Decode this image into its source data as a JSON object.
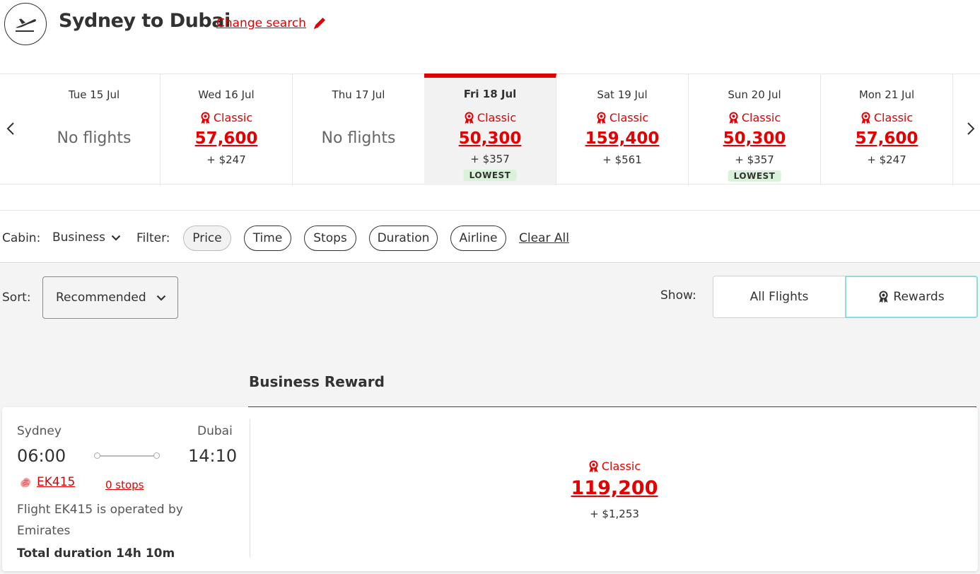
{
  "header": {
    "route_title": "Sydney to Dubai",
    "change_search": "Change search"
  },
  "dates": [
    {
      "label": "Tue 15 Jul",
      "no_flights": "No flights"
    },
    {
      "label": "Wed 16 Jul",
      "classic": "Classic",
      "points": "57,600",
      "tax": "+ $247"
    },
    {
      "label": "Thu 17 Jul",
      "no_flights": "No flights"
    },
    {
      "label": "Fri 18 Jul",
      "classic": "Classic",
      "points": "50,300",
      "tax": "+ $357",
      "badge": "LOWEST",
      "selected": true
    },
    {
      "label": "Sat 19 Jul",
      "classic": "Classic",
      "points": "159,400",
      "tax": "+ $561"
    },
    {
      "label": "Sun 20 Jul",
      "classic": "Classic",
      "points": "50,300",
      "tax": "+ $357",
      "badge": "LOWEST"
    },
    {
      "label": "Mon 21 Jul",
      "classic": "Classic",
      "points": "57,600",
      "tax": "+ $247"
    }
  ],
  "filters": {
    "cabin_label": "Cabin:",
    "cabin_value": "Business",
    "filter_label": "Filter:",
    "pills": [
      "Price",
      "Time",
      "Stops",
      "Duration",
      "Airline"
    ],
    "clear_all": "Clear All"
  },
  "sort": {
    "label": "Sort:",
    "value": "Recommended"
  },
  "show": {
    "label": "Show:",
    "all_flights": "All Flights",
    "rewards": "Rewards"
  },
  "cabin_header": "Business Reward",
  "flight": {
    "origin": "Sydney",
    "destination": "Dubai",
    "depart": "06:00",
    "arrive": "14:10",
    "flight_no": "EK415",
    "stops": "0 stops",
    "operated": "Flight EK415 is operated by Emirates",
    "duration": "Total duration 14h 10m",
    "fare": {
      "classic": "Classic",
      "points": "119,200",
      "tax": "+ $1,253"
    }
  },
  "colors": {
    "brand_red": "#e40000",
    "lowest_badge": "#d9f2d9",
    "rewards_border": "#8fdcdc"
  },
  "icons": {
    "header": "plane-takeoff-icon",
    "edit": "pencil-icon",
    "classic": "award-ribbon-icon",
    "airline": "emirates-logo-icon"
  }
}
